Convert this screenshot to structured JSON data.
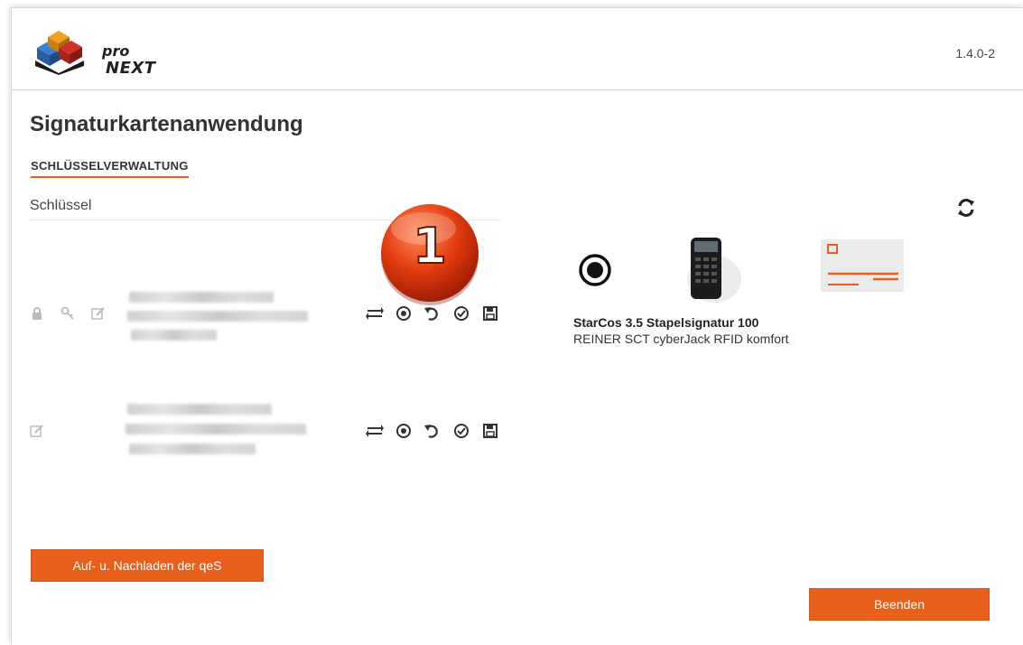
{
  "app": {
    "logo_line1": "pro",
    "logo_line2": "NEXT",
    "version": "1.4.0-2"
  },
  "page": {
    "title": "Signaturkartenanwendung",
    "tab_label": "SCHLÜSSELVERWALTUNG",
    "section_label": "Schlüssel"
  },
  "keys": [
    {
      "lead_icons": [
        "lock-icon",
        "key-icon",
        "edit-icon"
      ],
      "actions": [
        "swap-icon",
        "target-icon",
        "undo-icon",
        "check-circle-icon",
        "save-icon"
      ]
    },
    {
      "lead_icons": [
        "edit-icon"
      ],
      "actions": [
        "swap-icon",
        "target-icon",
        "undo-icon",
        "check-circle-icon",
        "save-icon"
      ]
    }
  ],
  "step_badge": "1",
  "card": {
    "name": "StarCos 3.5 Stapelsignatur 100",
    "reader": "REINER SCT cyberJack RFID komfort"
  },
  "buttons": {
    "load_label": "Auf- u. Nachladen der qeS",
    "exit_label": "Beenden"
  },
  "colors": {
    "accent": "#e8601c",
    "text": "#333333",
    "badge": "#e23c0f"
  }
}
